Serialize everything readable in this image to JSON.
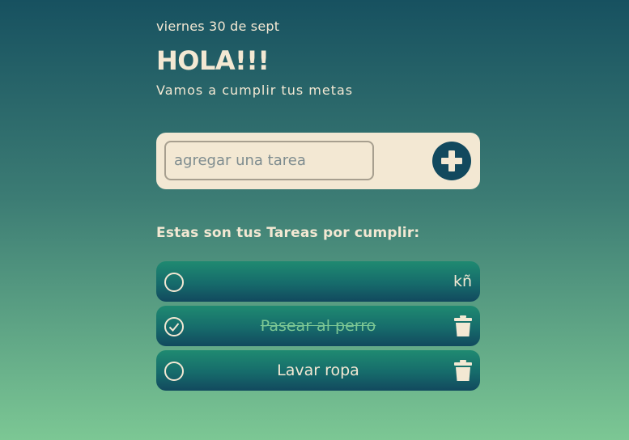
{
  "header": {
    "date": "viernes 30 de sept",
    "greeting": "HOLA!!!",
    "subtitle": "Vamos a cumplir tus metas"
  },
  "new_task": {
    "placeholder": "agregar una tarea",
    "value": "",
    "add_icon": "plus-circle-icon"
  },
  "tasks_section": {
    "title": "Estas son tus Tareas por cumplir:"
  },
  "tasks": [
    {
      "text": "kñ",
      "done": false,
      "check_icon": "circle-icon"
    },
    {
      "text": "Pasear al perro",
      "done": true,
      "check_icon": "check-circle-icon",
      "delete_icon": "trash-icon"
    },
    {
      "text": "Lavar ropa",
      "done": false,
      "check_icon": "circle-icon",
      "delete_icon": "trash-icon"
    }
  ],
  "colors": {
    "cream": "#f3e8d3",
    "dark_teal": "#12495e",
    "green": "#7cc794"
  }
}
